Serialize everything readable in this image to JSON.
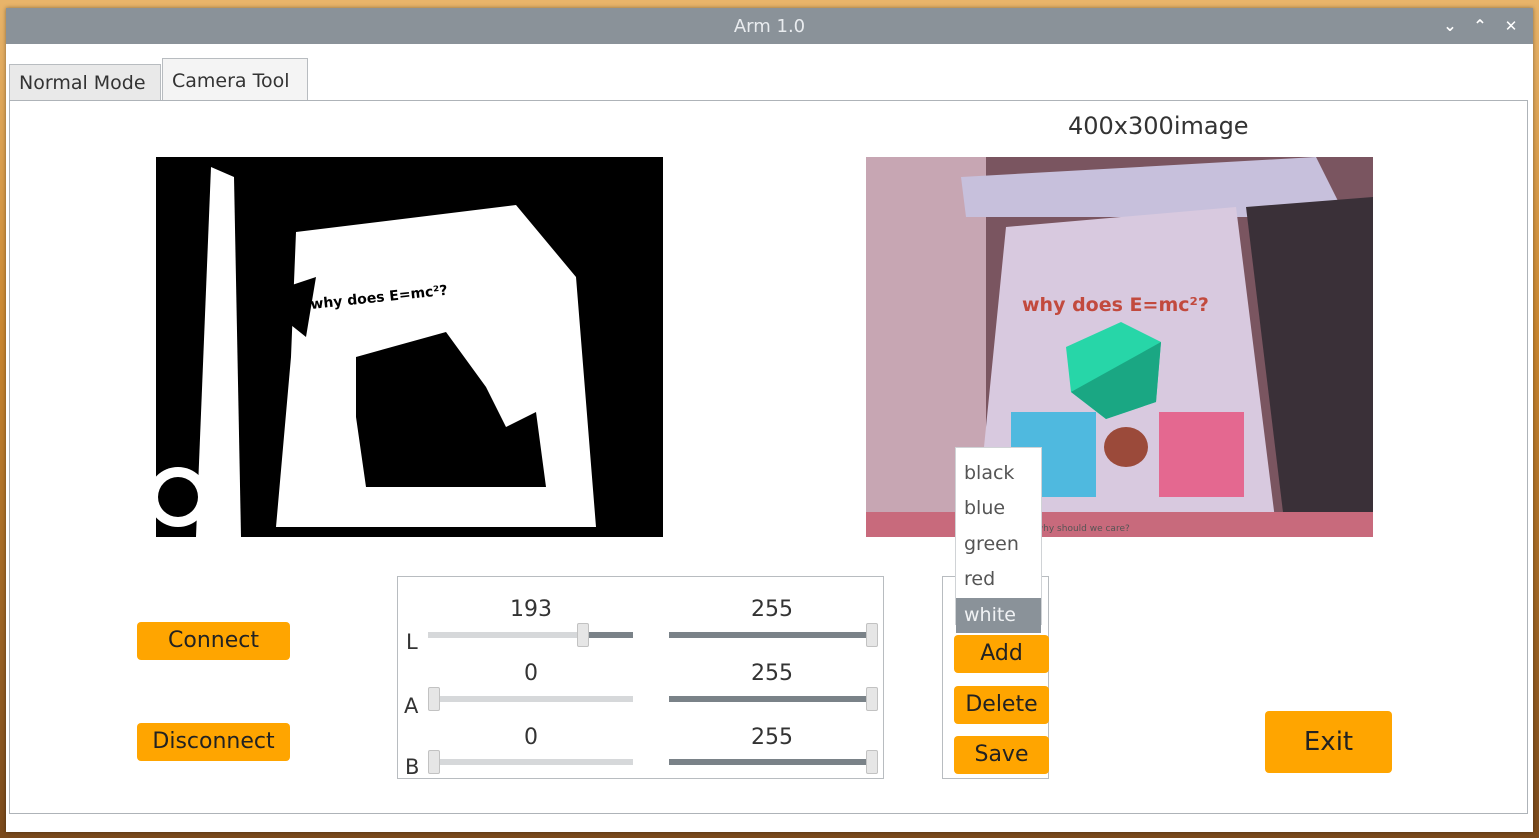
{
  "window": {
    "title": "Arm 1.0"
  },
  "window_controls": {
    "minimize": "⌄",
    "maximize": "⌃",
    "close": "✕"
  },
  "tabs": [
    {
      "label": "Normal Mode",
      "active": false
    },
    {
      "label": "Camera Tool",
      "active": true
    }
  ],
  "main": {
    "image_label": "400x300image",
    "connect_label": "Connect",
    "disconnect_label": "Disconnect",
    "exit_label": "Exit"
  },
  "camera_text": {
    "headline": "why does E=mc²?",
    "footer": "and why should we care?"
  },
  "sliders": {
    "rows": [
      {
        "axis": "L",
        "low": 193,
        "high": 255
      },
      {
        "axis": "A",
        "low": 0,
        "high": 255
      },
      {
        "axis": "B",
        "low": 0,
        "high": 255
      }
    ],
    "min": 0,
    "max": 255
  },
  "colors": {
    "items": [
      "black",
      "blue",
      "green",
      "red",
      "white"
    ],
    "selected": "white"
  },
  "actions": {
    "add_label": "Add",
    "delete_label": "Delete",
    "save_label": "Save"
  },
  "theme": {
    "accent": "#ffa500",
    "titlebar": "#8a9299"
  }
}
